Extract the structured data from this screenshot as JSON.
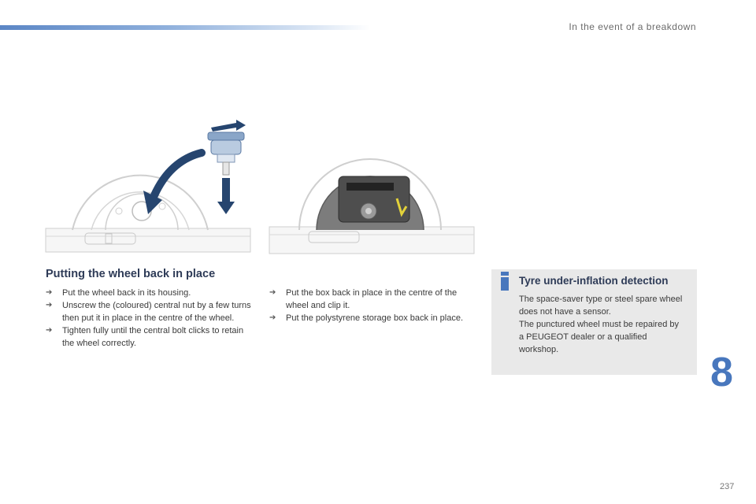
{
  "header": {
    "section_title": "In the event of a breakdown"
  },
  "main": {
    "heading": "Putting the wheel back in place",
    "steps_col1": [
      {
        "bullet": "➔",
        "text": "Put the wheel back in its housing."
      },
      {
        "bullet": "➔",
        "text": "Unscrew the (coloured) central nut by a few turns then put it in place in the centre of the wheel."
      },
      {
        "bullet": "➔",
        "text": "Tighten fully until the central bolt clicks to retain the wheel correctly."
      }
    ],
    "steps_col2": [
      {
        "bullet": "➔",
        "text": "Put the box back in place in the centre of the wheel and clip it."
      },
      {
        "bullet": "➔",
        "text": "Put the polystyrene storage box back in place."
      }
    ]
  },
  "info": {
    "icon": "info-i-icon",
    "title": "Tyre under-inflation detection",
    "paragraphs": [
      "The space-saver type or steel spare wheel does not have a sensor.",
      "The punctured wheel must be repaired by a PEUGEOT dealer or a qualified workshop."
    ]
  },
  "chapter": {
    "number": "8"
  },
  "footer": {
    "page_number": "237"
  },
  "colors": {
    "accent": "#4877bd",
    "heading": "#2e3b57",
    "info_bg": "#e9e9e9",
    "arrow": "#26456f"
  }
}
